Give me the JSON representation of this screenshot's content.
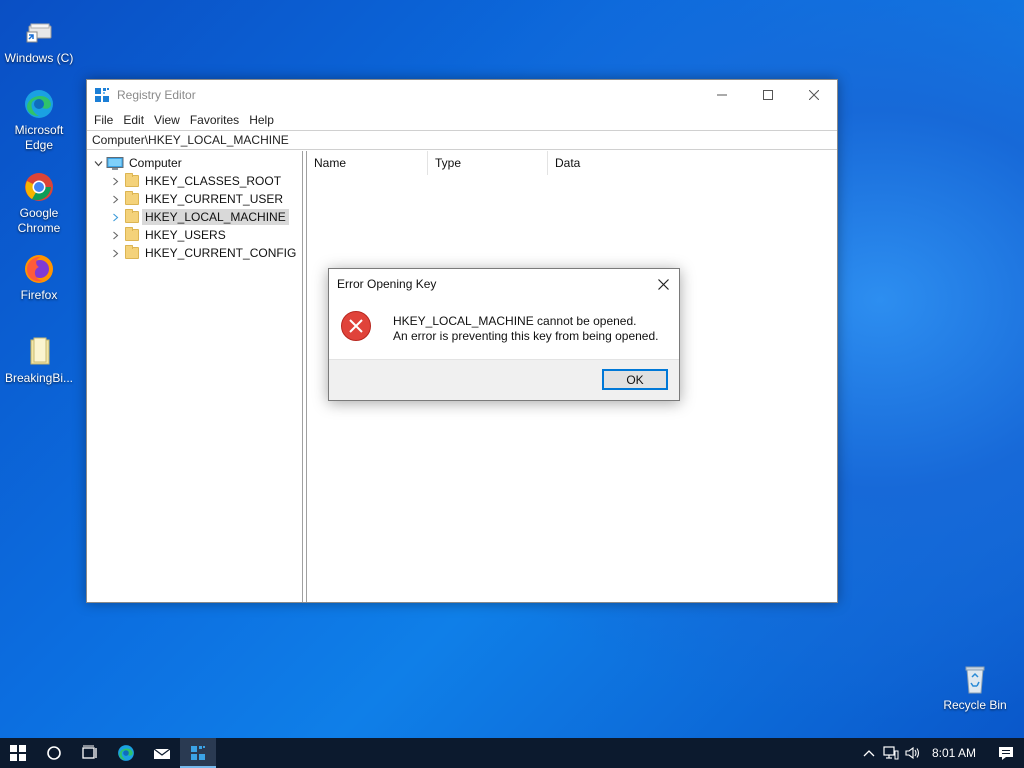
{
  "desktop": {
    "icons": [
      {
        "label": "Windows (C)",
        "icon": "drive-icon"
      },
      {
        "label": "Microsoft Edge",
        "icon": "edge-icon"
      },
      {
        "label": "Google Chrome",
        "icon": "chrome-icon"
      },
      {
        "label": "Firefox",
        "icon": "firefox-icon"
      },
      {
        "label": "BreakingBi...",
        "icon": "file-icon"
      },
      {
        "label": "Recycle Bin",
        "icon": "recycle-bin-icon"
      }
    ]
  },
  "window": {
    "title": "Registry Editor",
    "menu": [
      "File",
      "Edit",
      "View",
      "Favorites",
      "Help"
    ],
    "address": "Computer\\HKEY_LOCAL_MACHINE",
    "tree": {
      "root": "Computer",
      "children": [
        "HKEY_CLASSES_ROOT",
        "HKEY_CURRENT_USER",
        "HKEY_LOCAL_MACHINE",
        "HKEY_USERS",
        "HKEY_CURRENT_CONFIG"
      ],
      "selected": "HKEY_LOCAL_MACHINE"
    },
    "columns": [
      "Name",
      "Type",
      "Data"
    ]
  },
  "dialog": {
    "title": "Error Opening Key",
    "line1": "HKEY_LOCAL_MACHINE cannot be opened.",
    "line2": "An error is preventing this key from being opened.",
    "ok_label": "OK"
  },
  "taskbar": {
    "clock": "8:01 AM",
    "pinned": [
      "start-icon",
      "search-icon",
      "task-view-icon",
      "edge-icon",
      "mail-icon",
      "registry-editor-icon"
    ]
  },
  "colors": {
    "accent": "#0078d7",
    "error": "#e0433a",
    "taskbar": "#0c1a2e"
  }
}
